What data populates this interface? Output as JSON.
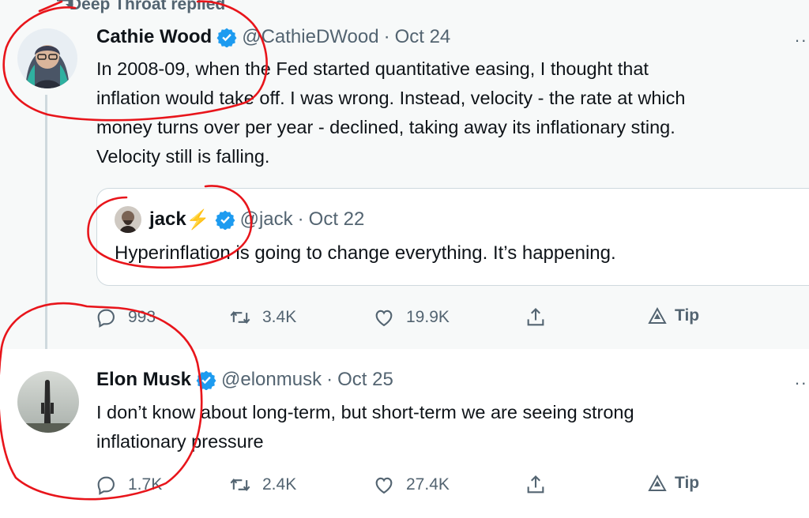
{
  "thread": {
    "context_label": "Deep Throat replied",
    "accent_blue": "#1d9bf0",
    "muted_gray": "#536471",
    "annotation_red": "#e8151b"
  },
  "tweets": [
    {
      "name": "Cathie Wood",
      "handle": "@CathieDWood",
      "separator": "·",
      "date": "Oct 24",
      "more": "··",
      "text": "In 2008-09, when the Fed started quantitative easing, I thought that\ninflation would take off. I was wrong. Instead, velocity - the rate at which\nmoney turns over per year - declined, taking away its inflationary sting.\nVelocity still is falling.",
      "quote": {
        "name": "jack",
        "emoji": "⚡",
        "handle": "@jack",
        "separator": "·",
        "date": "Oct 22",
        "text": "Hyperinflation is going to change everything. It’s happening."
      },
      "actions": {
        "replies": "993",
        "retweets": "3.4K",
        "likes": "19.9K",
        "tip": "Tip"
      }
    },
    {
      "name": "Elon Musk",
      "handle": "@elonmusk",
      "separator": "·",
      "date": "Oct 25",
      "more": "··",
      "text": "I don’t know about long-term, but short-term we are seeing strong\ninflationary pressure",
      "actions": {
        "replies": "1.7K",
        "retweets": "2.4K",
        "likes": "27.4K",
        "tip": "Tip"
      }
    }
  ],
  "icons": [
    "retweet-context-icon",
    "verified-icon",
    "reply-icon",
    "retweet-icon",
    "like-icon",
    "share-icon",
    "tip-icon",
    "more-icon"
  ]
}
